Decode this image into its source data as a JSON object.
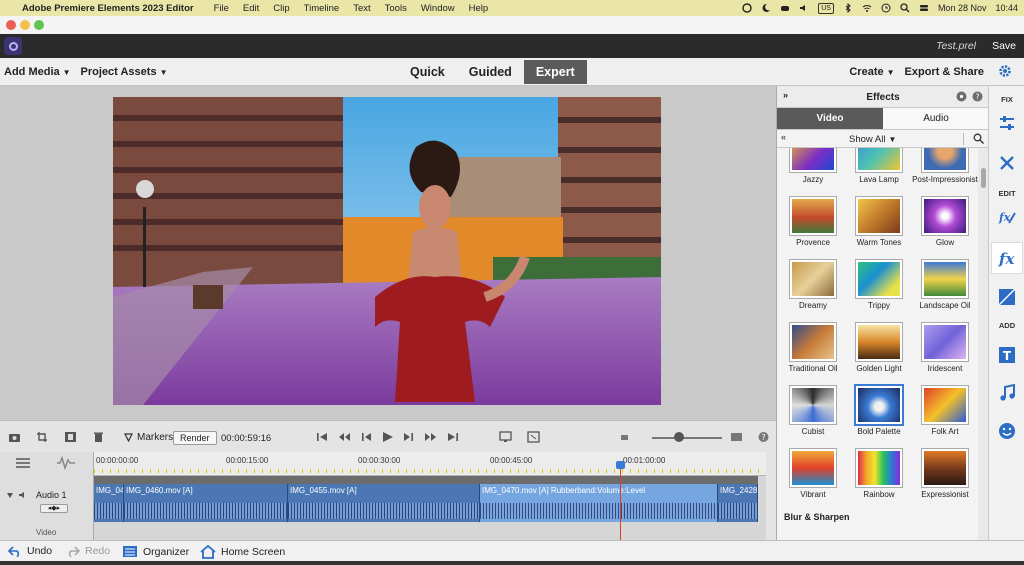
{
  "menubar": {
    "app_name": "Adobe Premiere Elements 2023 Editor",
    "items": [
      "File",
      "Edit",
      "Clip",
      "Timeline",
      "Text",
      "Tools",
      "Window",
      "Help"
    ],
    "input_source": "US",
    "date": "Mon 28 Nov",
    "time": "10:44"
  },
  "header": {
    "filename": "Test.prel",
    "save_label": "Save"
  },
  "toolbar": {
    "add_media": "Add Media",
    "project_assets": "Project Assets",
    "modes": [
      "Quick",
      "Guided",
      "Expert"
    ],
    "active_mode": "Expert",
    "create": "Create",
    "export_share": "Export & Share"
  },
  "timeline_controls": {
    "markers_label": "Markers",
    "render_label": "Render",
    "timecode": "00:00:59:16"
  },
  "timeline": {
    "ruler": [
      "00:00:00:00",
      "00:00:15:00",
      "00:00:30:00",
      "00:00:45:00",
      "00:01:00:00"
    ],
    "track_name": "Audio 1",
    "track_below": "Video",
    "clips": [
      {
        "label": "IMG_04"
      },
      {
        "label": "IMG_0460.mov [A]"
      },
      {
        "label": "IMG_0455.mov [A]"
      },
      {
        "label": "IMG_0470.mov [A] Rubberband:Volume:Level"
      },
      {
        "label": "IMG_2428"
      }
    ]
  },
  "bottombar": {
    "undo": "Undo",
    "redo": "Redo",
    "organizer": "Organizer",
    "home_screen": "Home Screen"
  },
  "effects_panel": {
    "title": "Effects",
    "tabs": [
      "Video",
      "Audio"
    ],
    "active_tab": "Video",
    "filter": "Show All",
    "effects": [
      {
        "name": "Jazzy"
      },
      {
        "name": "Lava Lamp"
      },
      {
        "name": "Post-Impressionist"
      },
      {
        "name": "Provence"
      },
      {
        "name": "Warm Tones"
      },
      {
        "name": "Glow"
      },
      {
        "name": "Dreamy"
      },
      {
        "name": "Trippy"
      },
      {
        "name": "Landscape Oil"
      },
      {
        "name": "Traditional Oil"
      },
      {
        "name": "Golden Light"
      },
      {
        "name": "Iridescent"
      },
      {
        "name": "Cubist"
      },
      {
        "name": "Bold Palette"
      },
      {
        "name": "Folk Art"
      },
      {
        "name": "Vibrant"
      },
      {
        "name": "Rainbow"
      },
      {
        "name": "Expressionist"
      }
    ],
    "selected_effect": "Bold Palette",
    "section_label": "Blur & Sharpen"
  },
  "side_strip": {
    "fix": "FIX",
    "edit": "EDIT",
    "add": "ADD"
  }
}
